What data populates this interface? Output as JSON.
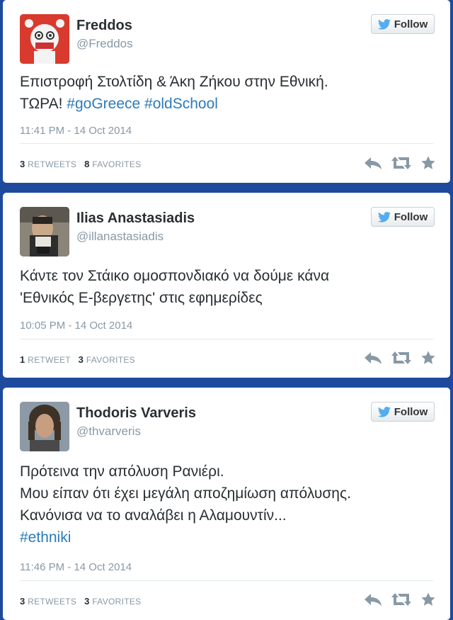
{
  "follow_label": "Follow",
  "tweets": [
    {
      "name": "Freddos",
      "handle": "@Freddos",
      "text_line1": "Επιστροφή Στολτίδη & Άκη Ζήκου στην Εθνική.",
      "text_line2_prefix": "ΤΩΡΑ! ",
      "hashtag1": "#goGreece",
      "hashtag2": "#oldSchool",
      "time": "11:41 PM - 14 Oct 2014",
      "retweets": "3",
      "retweets_label": "RETWEETS",
      "favorites": "8",
      "favorites_label": "FAVORITES"
    },
    {
      "name": "Ilias Anastasiadis",
      "handle": "@illanastasiadis",
      "text_line1": "Κάντε τον Στάικο ομοσπονδιακό να δούμε κάνα",
      "text_line2": "'Εθνικός Ε-βεργετης' στις εφημερίδες",
      "time": "10:05 PM - 14 Oct 2014",
      "retweets": "1",
      "retweets_label": "RETWEET",
      "favorites": "3",
      "favorites_label": "FAVORITES"
    },
    {
      "name": "Thodoris Varveris",
      "handle": "@thvarveris",
      "text_line1": "Πρότεινα την απόλυση Ρανιέρι.",
      "text_line2": "Μου είπαν ότι έχει μεγάλη αποζημίωση απόλυσης.",
      "text_line3": "Κανόνισα να το αναλάβει η Αλαμουντίν...",
      "hashtag": "#ethniki",
      "time": "11:46 PM - 14 Oct 2014",
      "retweets": "3",
      "retweets_label": "RETWEETS",
      "favorites": "3",
      "favorites_label": "FAVORITES"
    }
  ],
  "colors": {
    "background": "#1e4a9e",
    "link": "#2b7bb9",
    "twitter_bird": "#55acee"
  }
}
